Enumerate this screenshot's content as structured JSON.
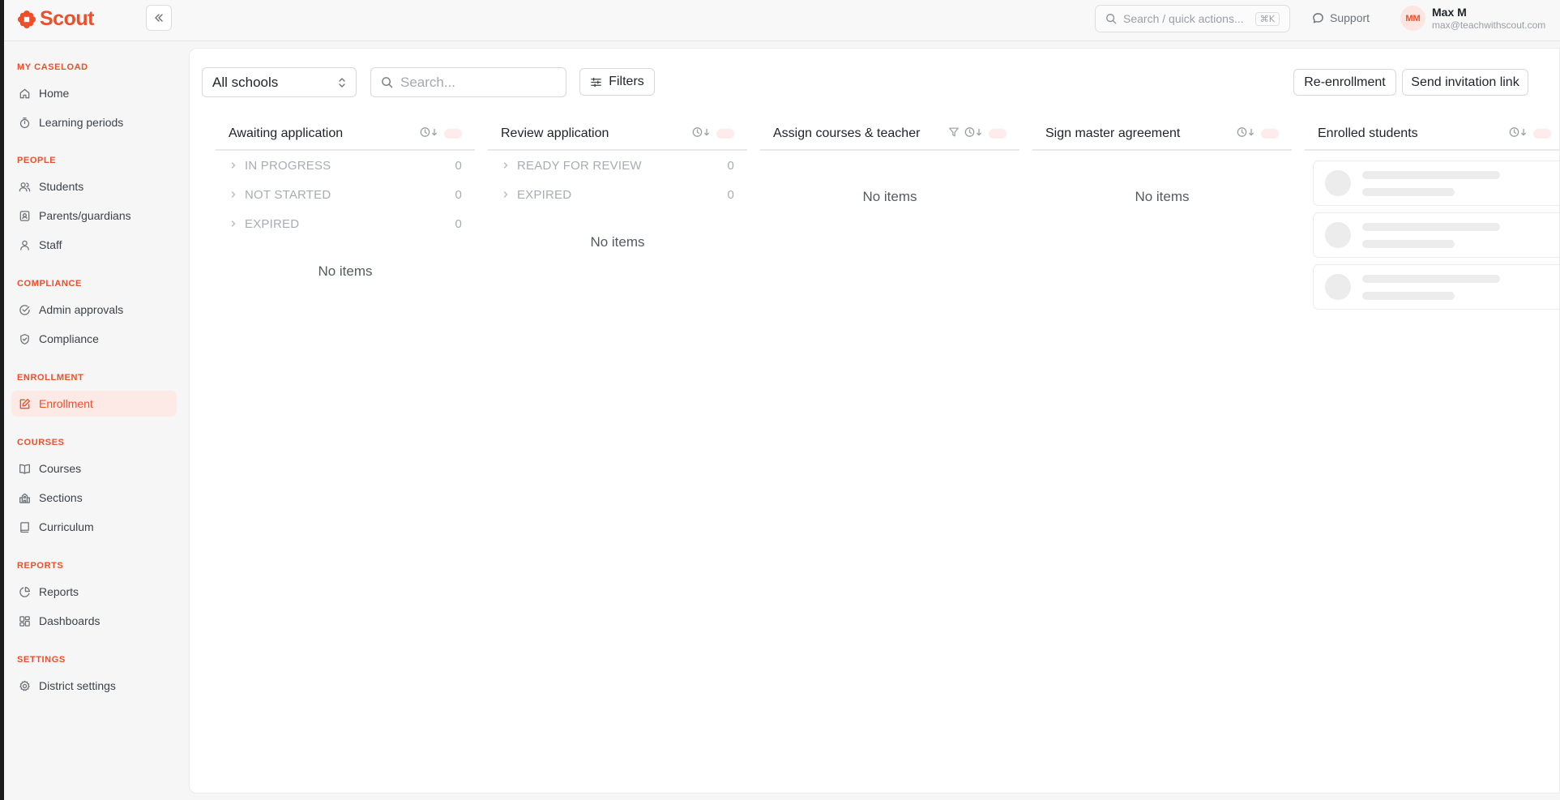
{
  "app": {
    "name": "Scout",
    "accent": "#ee4e2a"
  },
  "topbar": {
    "search_placeholder": "Search / quick actions...",
    "search_shortcut": "⌘K",
    "support_label": "Support",
    "user_initials": "MM",
    "user_name": "Max M",
    "user_email": "max@teachwithscout.com"
  },
  "sidebar": {
    "sections": {
      "caseload": "MY CASELOAD",
      "people": "PEOPLE",
      "compliance": "COMPLIANCE",
      "enrollment": "ENROLLMENT",
      "courses": "COURSES",
      "reports": "REPORTS",
      "settings": "SETTINGS"
    },
    "items": {
      "home": "Home",
      "learning_periods": "Learning periods",
      "students": "Students",
      "parents": "Parents/guardians",
      "staff": "Staff",
      "admin_approvals": "Admin approvals",
      "compliance": "Compliance",
      "enrollment": "Enrollment",
      "courses": "Courses",
      "sections": "Sections",
      "curriculum": "Curriculum",
      "reports": "Reports",
      "dashboards": "Dashboards",
      "district_settings": "District settings"
    },
    "active_item": "Enrollment"
  },
  "toolbar": {
    "school_select": "All schools",
    "search_placeholder": "Search...",
    "filters_label": "Filters",
    "reenrollment_label": "Re-enrollment",
    "invite_label": "Send invitation link"
  },
  "columns": {
    "awaiting": {
      "title": "Awaiting application",
      "groups": [
        {
          "label": "IN PROGRESS",
          "count": "0"
        },
        {
          "label": "NOT STARTED",
          "count": "0"
        },
        {
          "label": "EXPIRED",
          "count": "0"
        }
      ],
      "empty": "No items"
    },
    "review": {
      "title": "Review application",
      "groups": [
        {
          "label": "READY FOR REVIEW",
          "count": "0"
        },
        {
          "label": "EXPIRED",
          "count": "0"
        }
      ],
      "empty": "No items"
    },
    "assign": {
      "title": "Assign courses & teacher",
      "empty": "No items"
    },
    "master": {
      "title": "Sign master agreement",
      "empty": "No items"
    },
    "enrolled": {
      "title": "Enrolled students"
    }
  }
}
